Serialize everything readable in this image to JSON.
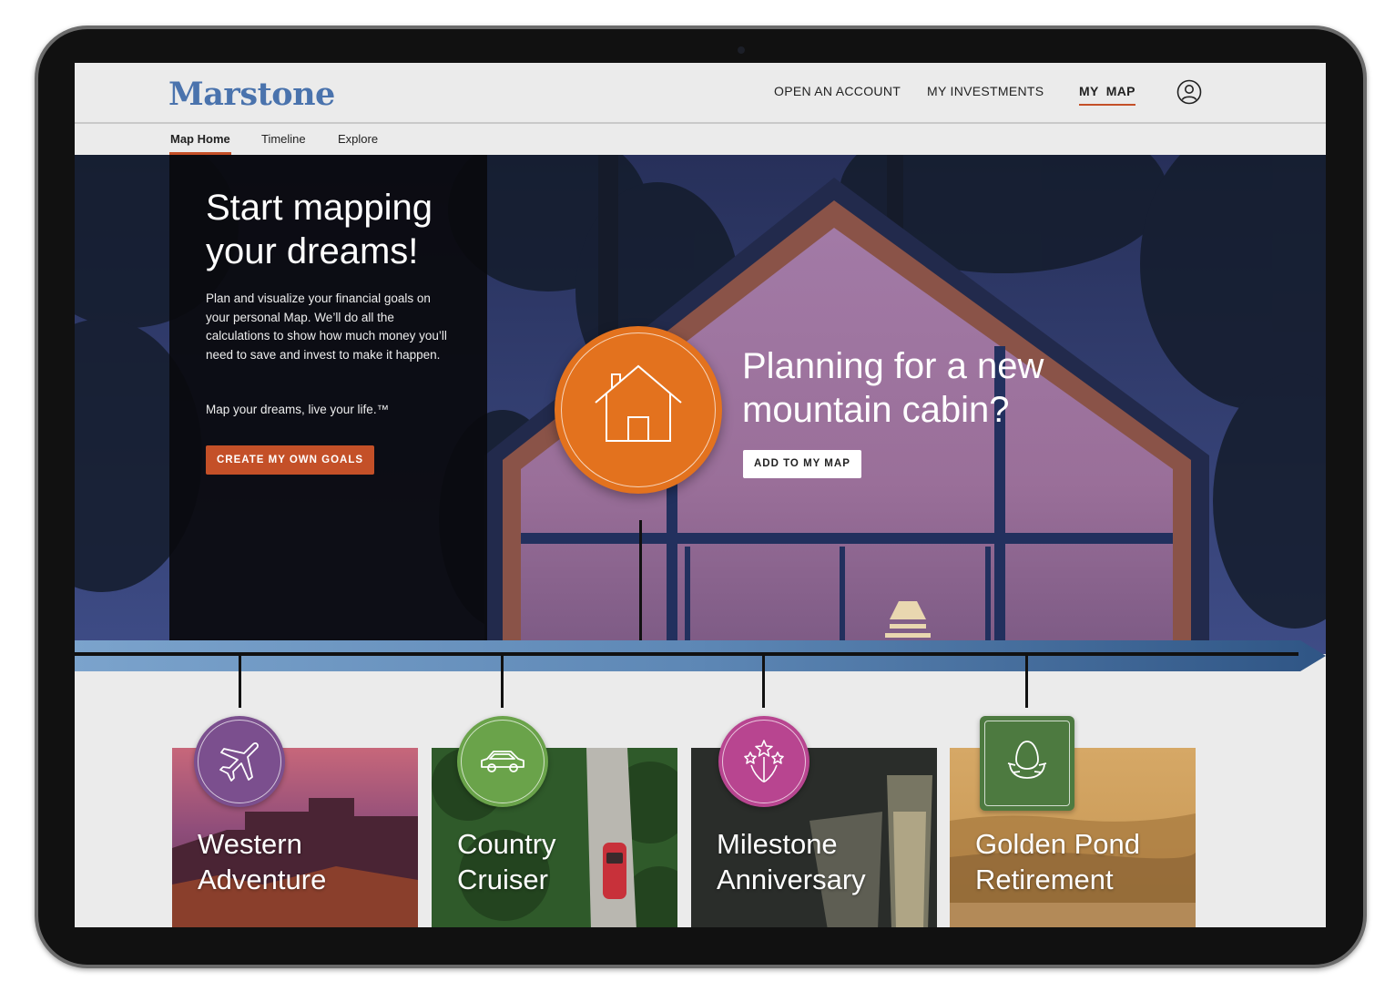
{
  "brand": {
    "logo_text": "Marstone",
    "accent_color": "#c45028",
    "logo_color": "#4a73ad"
  },
  "header_nav": {
    "items": [
      {
        "label": "OPEN AN ACCOUNT"
      },
      {
        "label": "MY INVESTMENTS"
      },
      {
        "label": "MY  MAP",
        "active": true
      }
    ],
    "account_icon": "user-circle-icon"
  },
  "subnav": {
    "tabs": [
      {
        "label": "Map Home",
        "active": true
      },
      {
        "label": "Timeline"
      },
      {
        "label": "Explore"
      }
    ]
  },
  "intro": {
    "title": "Start mapping your dreams!",
    "body": "Plan and visualize your financial goals on your personal Map. We’ll do all the calculations to show how much money you’ll need to save and invest to make it happen.",
    "tagline": "Map your dreams, live your life.™",
    "cta_label": "CREATE MY OWN GOALS"
  },
  "featured_goal": {
    "icon": "house-icon",
    "color": "#e3721e",
    "title": "Planning for a new mountain cabin?",
    "cta_label": "ADD TO MY MAP"
  },
  "goal_cards": [
    {
      "title_line1": "Western",
      "title_line2": "Adventure",
      "icon": "airplane-icon",
      "color": "#7b4f8e"
    },
    {
      "title_line1": "Country",
      "title_line2": "Cruiser",
      "icon": "car-icon",
      "color": "#6aa34a"
    },
    {
      "title_line1": "Milestone",
      "title_line2": "Anniversary",
      "icon": "fireworks-icon",
      "color": "#b84590"
    },
    {
      "title_line1": "Golden Pond",
      "title_line2": "Retirement",
      "icon": "nest-egg-icon",
      "color": "#4d7a40"
    }
  ]
}
